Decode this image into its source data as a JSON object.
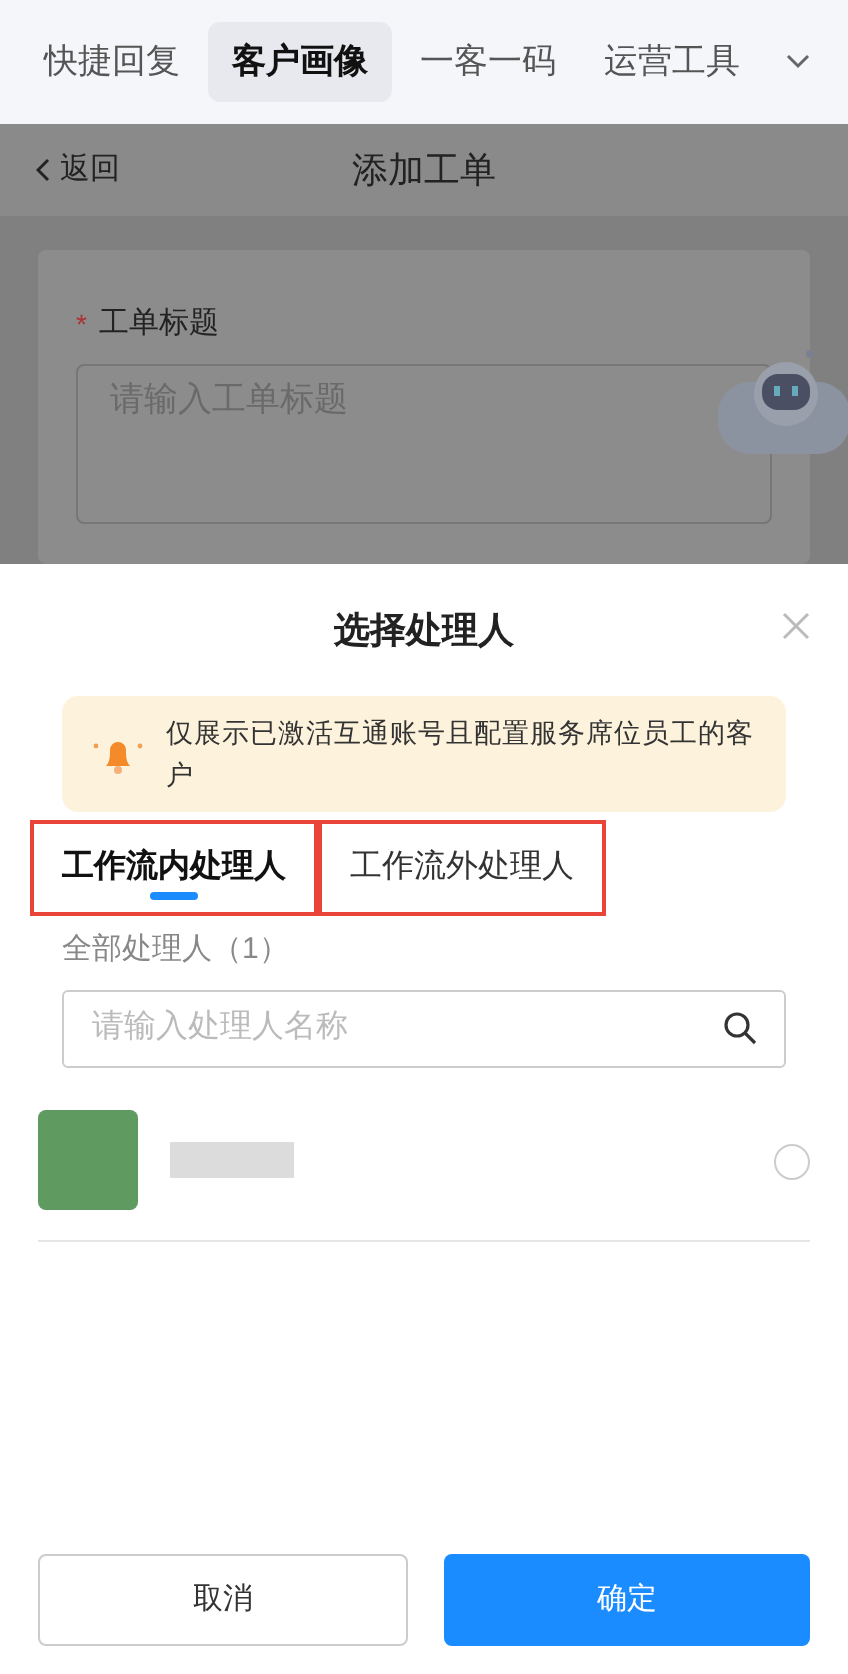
{
  "top_tabs": [
    {
      "label": "快捷回复",
      "selected": false
    },
    {
      "label": "客户画像",
      "selected": true
    },
    {
      "label": "一客一码",
      "selected": false
    },
    {
      "label": "运营工具",
      "selected": false
    }
  ],
  "page": {
    "back": "返回",
    "title": "添加工单",
    "field": {
      "label": "工单标题",
      "required_mark": "*",
      "placeholder": "请输入工单标题"
    }
  },
  "sheet": {
    "title": "选择处理人",
    "notice": "仅展示已激活互通账号且配置服务席位员工的客户",
    "tabs": [
      {
        "label": "工作流内处理人",
        "selected": true
      },
      {
        "label": "工作流外处理人",
        "selected": false
      }
    ],
    "count_label": "全部处理人（1）",
    "search": {
      "placeholder": "请输入处理人名称"
    },
    "handlers": [
      {
        "selected": false
      }
    ],
    "buttons": [
      {
        "label": "取消",
        "kind": "secondary"
      },
      {
        "label": "确定",
        "kind": "primary"
      }
    ]
  }
}
